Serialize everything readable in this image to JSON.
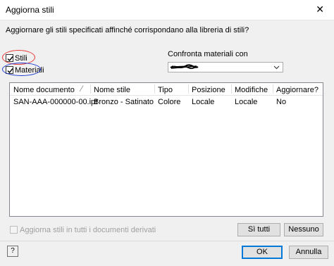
{
  "window": {
    "title": "Aggiorna stili",
    "close_glyph": "✕"
  },
  "prompt": "Aggiornare gli stili specificati affinché corrispondano alla libreria di stili?",
  "options": {
    "styles": {
      "label": "Stili",
      "checked": true
    },
    "materials": {
      "label": "Materiali",
      "checked": true
    }
  },
  "annotations": {
    "styles_circle_color": "#e53935",
    "materials_circle_color": "#1e3ccf"
  },
  "compare": {
    "label": "Confronta materiali con",
    "value_redacted": true
  },
  "table": {
    "headers": [
      "Nome documento",
      "Nome stile",
      "Tipo",
      "Posizione",
      "Modifiche",
      "Aggiornare?"
    ],
    "header_slash": "⁄",
    "rows": [
      [
        "SAN-AAA-000000-00.ipt",
        "Bronzo - Satinato",
        "Colore",
        "Locale",
        "Locale",
        "No"
      ]
    ]
  },
  "update_all_derived": {
    "label": "Aggiorna stili in tutti i documenti derivati",
    "checked": false,
    "enabled": false
  },
  "buttons": {
    "yes_all": "Sì tutti",
    "none": "Nessuno",
    "ok": "OK",
    "cancel": "Annulla",
    "help": "?"
  },
  "colors": {
    "accent": "#0078d7"
  }
}
